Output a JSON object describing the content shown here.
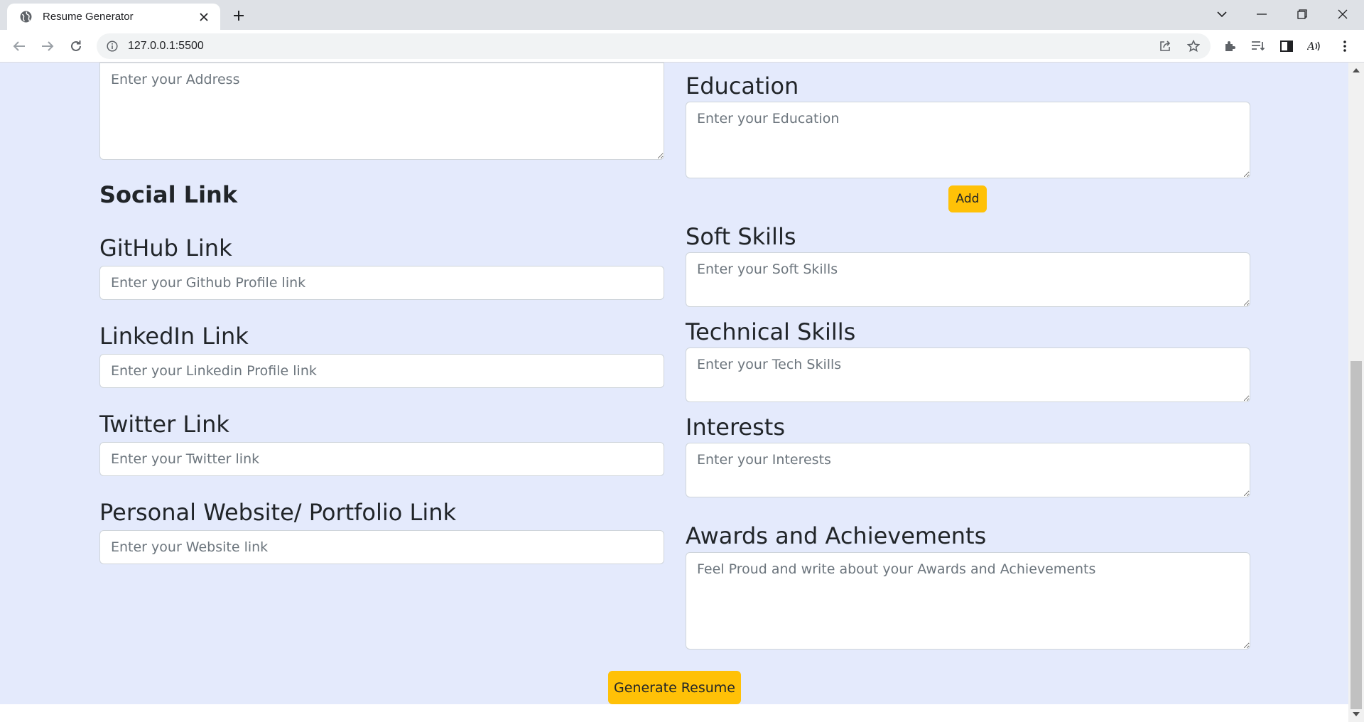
{
  "browser": {
    "tab_title": "Resume Generator",
    "url": "127.0.0.1:5500"
  },
  "form": {
    "address": {
      "placeholder": "Enter your Address"
    },
    "education": {
      "label": "Education",
      "placeholder": "Enter your Education",
      "add_button": "Add"
    },
    "social_heading": "Social Link",
    "github": {
      "label": "GitHub Link",
      "placeholder": "Enter your Github Profile link"
    },
    "linkedin": {
      "label": "LinkedIn Link",
      "placeholder": "Enter your Linkedin Profile link"
    },
    "twitter": {
      "label": "Twitter Link",
      "placeholder": "Enter your Twitter link"
    },
    "website": {
      "label": "Personal Website/ Portfolio Link",
      "placeholder": "Enter your Website link"
    },
    "soft_skills": {
      "label": "Soft Skills",
      "placeholder": "Enter your Soft Skills"
    },
    "technical_skills": {
      "label": "Technical Skills",
      "placeholder": "Enter your Tech Skills"
    },
    "interests": {
      "label": "Interests",
      "placeholder": "Enter your Interests"
    },
    "awards": {
      "label": "Awards and Achievements",
      "placeholder": "Feel Proud and write about your Awards and Achievements"
    },
    "generate_button": "Generate Resume"
  },
  "colors": {
    "page_background": "#e4eafc",
    "button_accent": "#ffc107"
  }
}
